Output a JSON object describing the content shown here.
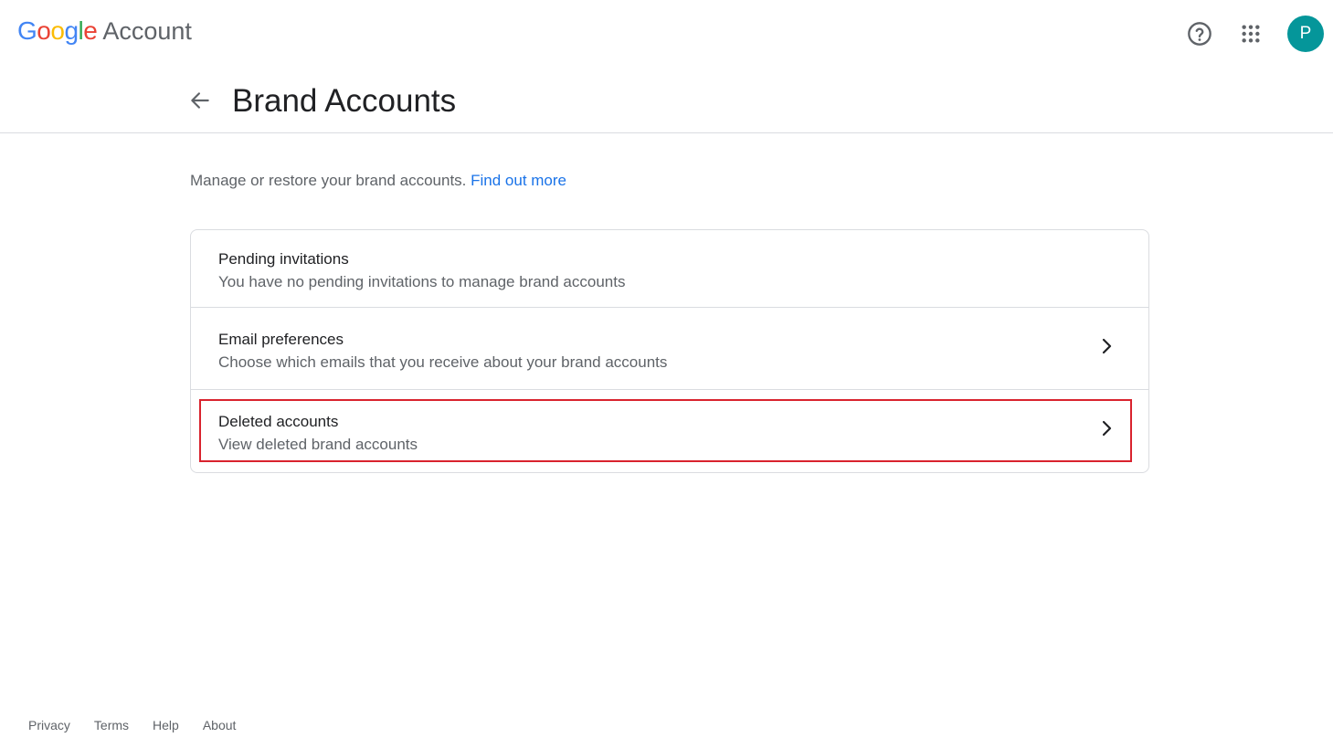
{
  "header": {
    "logo_text": "Google",
    "product_name": "Account",
    "help_icon": "help-circle-icon",
    "apps_icon": "apps-grid-icon",
    "avatar_initial": "P",
    "avatar_color": "#05969a"
  },
  "page": {
    "back_icon": "arrow-left-icon",
    "title": "Brand Accounts",
    "intro_text": "Manage or restore your brand accounts.",
    "intro_link": "Find out more"
  },
  "card": {
    "items": [
      {
        "title": "Pending invitations",
        "description": "You have no pending invitations to manage brand accounts",
        "has_chevron": false
      },
      {
        "title": "Email preferences",
        "description": "Choose which emails that you receive about your brand accounts",
        "has_chevron": true
      },
      {
        "title": "Deleted accounts",
        "description": "View deleted brand accounts",
        "has_chevron": true,
        "highlighted": true
      }
    ],
    "chevron_icon": "chevron-right-icon",
    "highlight_color": "#d9232e"
  },
  "footer": {
    "links": [
      "Privacy",
      "Terms",
      "Help",
      "About"
    ]
  },
  "colors": {
    "link": "#1a73e8",
    "text_primary": "#202124",
    "text_secondary": "#5f6368",
    "divider": "#dadce0"
  }
}
